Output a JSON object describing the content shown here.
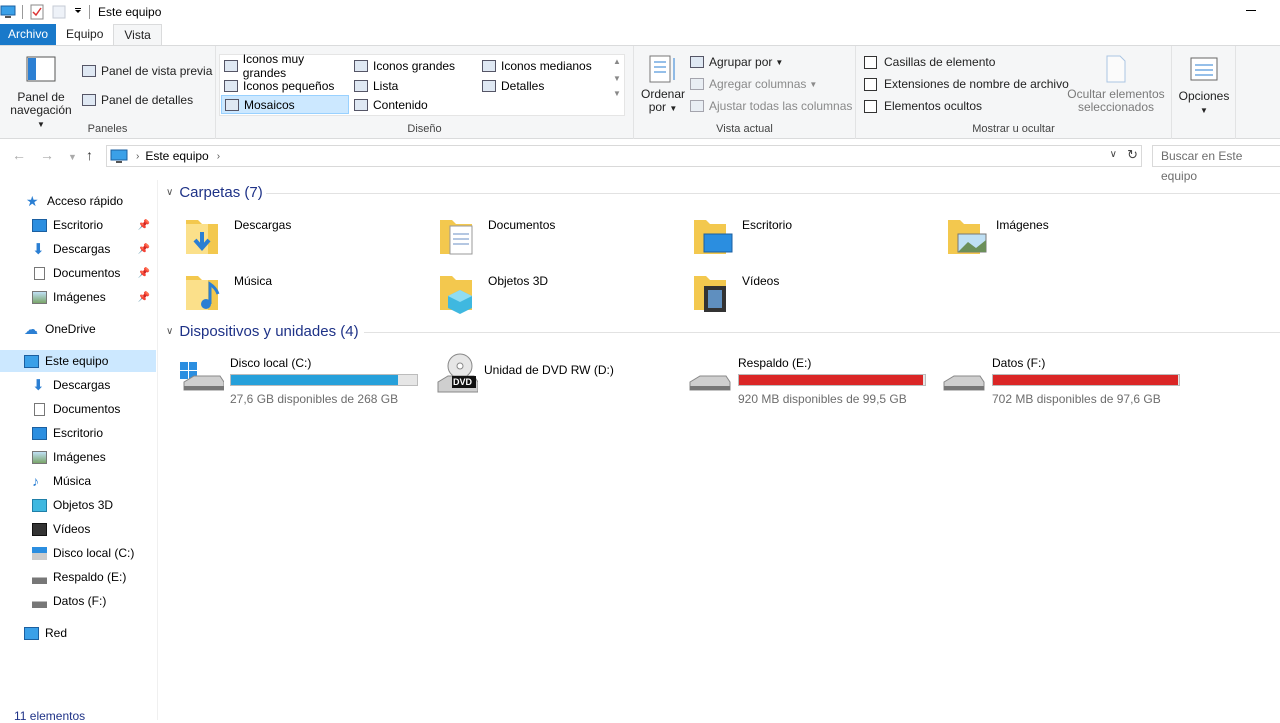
{
  "window": {
    "title": "Este equipo"
  },
  "ribbon_tabs": [
    "Archivo",
    "Equipo",
    "Vista"
  ],
  "ribbon": {
    "paneles": {
      "label": "Paneles",
      "panel_navegacion": "Panel de navegación",
      "vista_previa": "Panel de vista previa",
      "detalles": "Panel de detalles"
    },
    "diseno": {
      "label": "Diseño",
      "items": [
        "Iconos muy grandes",
        "Iconos grandes",
        "Iconos medianos",
        "Iconos pequeños",
        "Lista",
        "Detalles",
        "Mosaicos",
        "Contenido"
      ],
      "selected": "Mosaicos"
    },
    "vista_actual": {
      "label": "Vista actual",
      "ordenar": "Ordenar por",
      "agrupar": "Agrupar por",
      "agregar_columnas": "Agregar columnas",
      "ajustar": "Ajustar todas las columnas"
    },
    "mostrar": {
      "label": "Mostrar u ocultar",
      "casillas": "Casillas de elemento",
      "extensiones": "Extensiones de nombre de archivo",
      "ocultos": "Elementos ocultos",
      "ocultar_sel": "Ocultar elementos seleccionados"
    },
    "opciones": "Opciones"
  },
  "address": {
    "crumb": "Este equipo",
    "search_placeholder": "Buscar en Este equipo"
  },
  "nav": {
    "acceso_rapido": "Acceso rápido",
    "quick": [
      "Escritorio",
      "Descargas",
      "Documentos",
      "Imágenes"
    ],
    "onedrive": "OneDrive",
    "este_equipo": "Este equipo",
    "equipo_items": [
      "Descargas",
      "Documentos",
      "Escritorio",
      "Imágenes",
      "Música",
      "Objetos 3D",
      "Vídeos",
      "Disco local (C:)",
      "Respaldo (E:)",
      "Datos (F:)"
    ],
    "red": "Red"
  },
  "content": {
    "folders_header": "Carpetas (7)",
    "folders": [
      "Descargas",
      "Documentos",
      "Escritorio",
      "Imágenes",
      "Música",
      "Objetos 3D",
      "Vídeos"
    ],
    "devices_header": "Dispositivos y unidades (4)",
    "devices": [
      {
        "name": "Disco local (C:)",
        "free": "27,6 GB disponibles de 268 GB",
        "used_fraction": 0.897,
        "color": "#26a0da"
      },
      {
        "name": "Unidad de DVD RW (D:)",
        "free": "",
        "used_fraction": null,
        "color": ""
      },
      {
        "name": "Respaldo (E:)",
        "free": "920 MB disponibles de 99,5 GB",
        "used_fraction": 0.991,
        "color": "#da2626"
      },
      {
        "name": "Datos (F:)",
        "free": "702 MB disponibles de 97,6 GB",
        "used_fraction": 0.993,
        "color": "#da2626"
      }
    ],
    "dvd_label": "DVD"
  },
  "status": "11 elementos"
}
